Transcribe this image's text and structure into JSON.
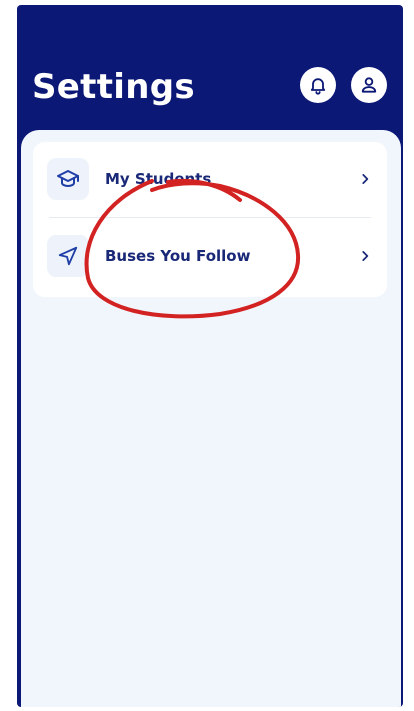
{
  "header": {
    "title": "Settings",
    "bell_icon": "bell-icon",
    "profile_icon": "user-icon"
  },
  "settings": {
    "items": [
      {
        "label": "My Students",
        "icon": "graduation-cap-icon"
      },
      {
        "label": "Buses You Follow",
        "icon": "navigation-arrow-icon"
      }
    ]
  },
  "colors": {
    "header_bg": "#0c1876",
    "content_bg": "#f1f6fd",
    "card_bg": "#ffffff",
    "label_text": "#1a2878",
    "icon_stroke": "#1f3fa6",
    "annotation_red": "#d32222"
  }
}
